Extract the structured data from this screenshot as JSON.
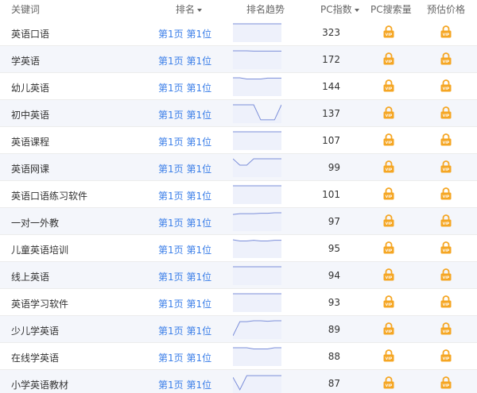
{
  "header": {
    "keyword": "关键词",
    "rank": "排名",
    "trend": "排名趋势",
    "pc_index": "PC指数",
    "pc_search": "PC搜索量",
    "price": "预估价格"
  },
  "colors": {
    "link": "#3a7ee8",
    "vip": "#f5a623",
    "spark_line": "#7b8ed9",
    "spark_fill": "#eef1fb"
  },
  "icons": {
    "vip": "vip-lock-icon",
    "sort": "caret-down-icon"
  },
  "rows": [
    {
      "keyword": "英语口语",
      "rank": "第1页 第1位",
      "pc_index": "323",
      "trend": [
        1,
        1,
        1,
        1,
        1,
        1,
        1,
        1
      ]
    },
    {
      "keyword": "学英语",
      "rank": "第1页 第1位",
      "pc_index": "172",
      "trend": [
        1,
        1,
        1,
        0.98,
        0.98,
        0.98,
        0.98,
        0.98
      ]
    },
    {
      "keyword": "幼儿英语",
      "rank": "第1页 第1位",
      "pc_index": "144",
      "trend": [
        1,
        1,
        0.93,
        0.93,
        0.93,
        0.98,
        0.98,
        0.98
      ]
    },
    {
      "keyword": "初中英语",
      "rank": "第1页 第1位",
      "pc_index": "137",
      "trend": [
        1,
        1,
        1,
        1,
        0.1,
        0.1,
        0.1,
        1
      ]
    },
    {
      "keyword": "英语课程",
      "rank": "第1页 第1位",
      "pc_index": "107",
      "trend": [
        1,
        1,
        1,
        1,
        1,
        1,
        1,
        1
      ]
    },
    {
      "keyword": "英语网课",
      "rank": "第1页 第1位",
      "pc_index": "99",
      "trend": [
        1,
        0.62,
        0.62,
        1,
        1,
        1,
        1,
        1
      ]
    },
    {
      "keyword": "英语口语练习软件",
      "rank": "第1页 第1位",
      "pc_index": "101",
      "trend": [
        1,
        1,
        1,
        1,
        1,
        1,
        1,
        1
      ]
    },
    {
      "keyword": "一对一外教",
      "rank": "第1页 第1位",
      "pc_index": "97",
      "trend": [
        0.9,
        0.95,
        0.95,
        0.95,
        0.97,
        0.97,
        1,
        1
      ]
    },
    {
      "keyword": "儿童英语培训",
      "rank": "第1页 第1位",
      "pc_index": "95",
      "trend": [
        1,
        0.93,
        0.93,
        0.97,
        0.93,
        0.93,
        0.97,
        0.97
      ]
    },
    {
      "keyword": "线上英语",
      "rank": "第1页 第1位",
      "pc_index": "94",
      "trend": [
        1,
        1,
        1,
        1,
        1,
        1,
        1,
        1
      ]
    },
    {
      "keyword": "英语学习软件",
      "rank": "第1页 第1位",
      "pc_index": "93",
      "trend": [
        1,
        1,
        1,
        1,
        1,
        1,
        1,
        1
      ]
    },
    {
      "keyword": "少儿学英语",
      "rank": "第1页 第1位",
      "pc_index": "89",
      "trend": [
        0.1,
        0.95,
        0.95,
        1,
        1,
        0.97,
        1,
        1
      ]
    },
    {
      "keyword": "在线学英语",
      "rank": "第1页 第1位",
      "pc_index": "88",
      "trend": [
        1,
        1,
        1,
        0.93,
        0.93,
        0.93,
        1,
        1
      ]
    },
    {
      "keyword": "小学英语教材",
      "rank": "第1页 第1位",
      "pc_index": "87",
      "trend": [
        0.85,
        0.1,
        0.95,
        0.95,
        0.95,
        0.95,
        0.95,
        0.95
      ]
    }
  ]
}
